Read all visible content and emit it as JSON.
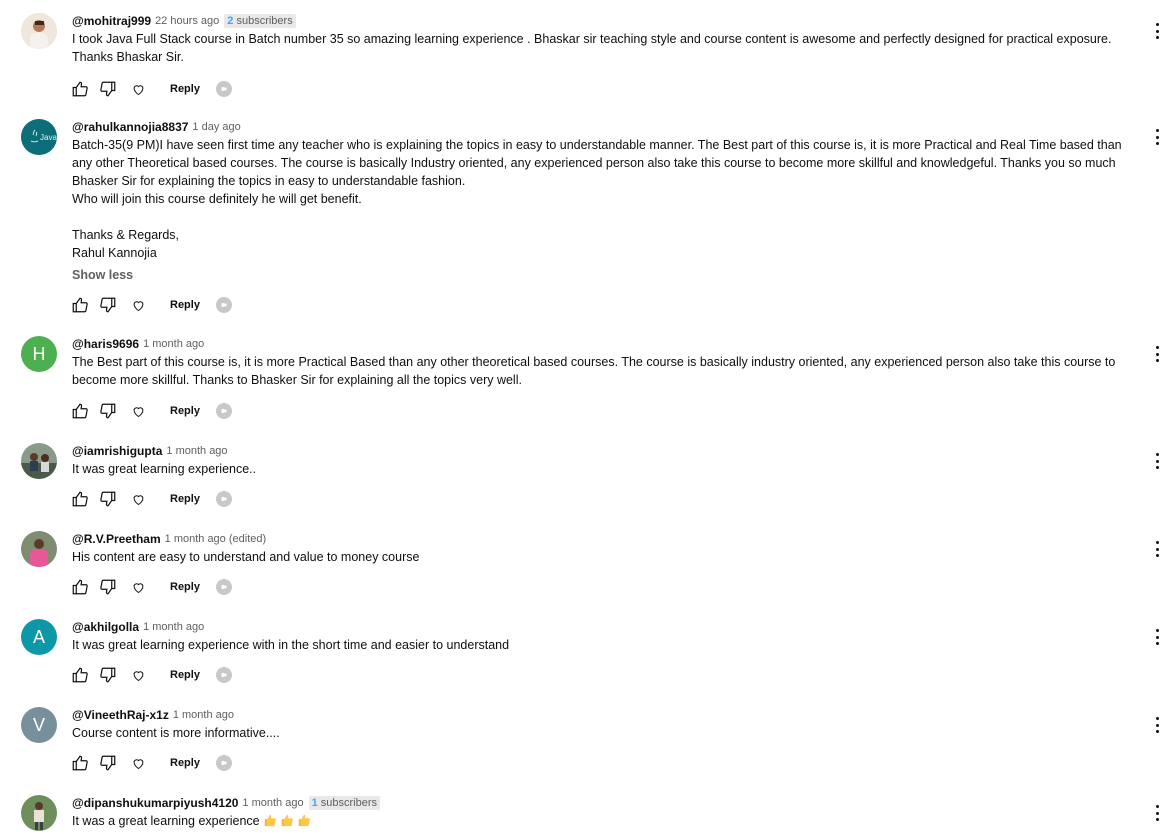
{
  "comments": [
    {
      "handle": "@mohitraj999",
      "time": "22 hours ago",
      "subscribers_count": "2",
      "subscribers_word": "subscribers",
      "avatar_type": "photo",
      "text": "I took Java Full Stack course in Batch number 35 so amazing learning experience . Bhaskar sir teaching style and course content is awesome and perfectly designed for practical exposure. Thanks Bhaskar Sir.",
      "reply_label": "Reply"
    },
    {
      "handle": "@rahulkannojia8837",
      "time": "1 day ago",
      "avatar_type": "java-logo",
      "avatar_text": "Java",
      "text": "Batch-35(9 PM)I have seen first time any teacher who is explaining the topics in easy to understandable manner. The Best part of this course is, it is more Practical and Real Time based than any other Theoretical based courses. The course is basically Industry oriented, any experienced person also take this course to become more skillful and knowledgeful. Thanks you so much Bhasker Sir for explaining the topics in easy to understandable fashion.\nWho will join this course definitely he will get benefit.\n\nThanks & Regards,\nRahul Kannojia",
      "show_less": "Show less",
      "reply_label": "Reply"
    },
    {
      "handle": "@haris9696",
      "time": "1 month ago",
      "avatar_type": "letter",
      "avatar_letter": "H",
      "avatar_color": "#4caf50",
      "text": "The Best part of this course is, it is more Practical Based than any other theoretical based courses. The course is basically industry oriented, any experienced person also take this course to become more skillful. Thanks to Bhasker Sir for explaining all the topics very well.",
      "reply_label": "Reply"
    },
    {
      "handle": "@iamrishigupta",
      "time": "1 month ago",
      "avatar_type": "photo",
      "text": "It was great learning experience..",
      "reply_label": "Reply"
    },
    {
      "handle": "@R.V.Preetham",
      "time": "1 month ago (edited)",
      "avatar_type": "photo",
      "text": "His content are easy to understand and value to money course",
      "reply_label": "Reply"
    },
    {
      "handle": "@akhilgolla",
      "time": "1 month ago",
      "avatar_type": "letter",
      "avatar_letter": "A",
      "avatar_color": "#0d98a8",
      "text": "It was great learning experience with in the short time and easier to understand",
      "reply_label": "Reply"
    },
    {
      "handle": "@VineethRaj-x1z",
      "time": "1 month ago",
      "avatar_type": "letter",
      "avatar_letter": "V",
      "avatar_color": "#78909c",
      "text": "Course content is more informative....",
      "reply_label": "Reply"
    },
    {
      "handle": "@dipanshukumarpiyush4120",
      "time": "1 month ago",
      "subscribers_count": "1",
      "subscribers_word": "subscribers",
      "avatar_type": "photo",
      "text": "It was a great learning experience",
      "emojis": [
        "thumbs-up",
        "thumbs-up",
        "thumbs-up"
      ],
      "reply_label": "Reply"
    }
  ],
  "icons": {
    "like": "thumbs-up-icon",
    "dislike": "thumbs-down-icon",
    "heart": "heart-icon",
    "creator": "creator-avatar-icon",
    "more": "more-vert-icon"
  }
}
